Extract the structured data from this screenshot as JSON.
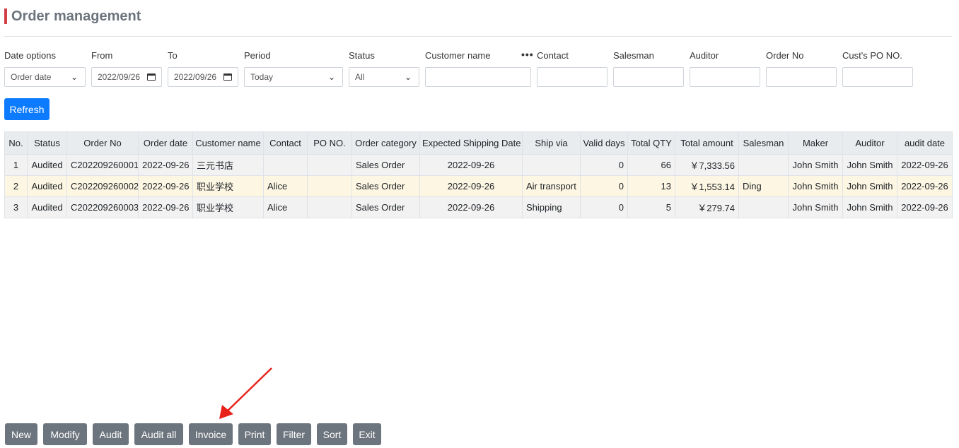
{
  "page": {
    "title": "Order management"
  },
  "filters": {
    "date_options": {
      "label": "Date options",
      "value": "Order date"
    },
    "from": {
      "label": "From",
      "value": "2022/09/26"
    },
    "to": {
      "label": "To",
      "value": "2022/09/26"
    },
    "period": {
      "label": "Period",
      "value": "Today"
    },
    "status": {
      "label": "Status",
      "value": "All"
    },
    "customer_name": {
      "label": "Customer name",
      "more": "•••",
      "value": ""
    },
    "contact": {
      "label": "Contact",
      "value": ""
    },
    "salesman": {
      "label": "Salesman",
      "value": ""
    },
    "auditor": {
      "label": "Auditor",
      "value": ""
    },
    "order_no": {
      "label": "Order No",
      "value": ""
    },
    "cust_po": {
      "label": "Cust's PO NO.",
      "value": ""
    }
  },
  "refresh_label": "Refresh",
  "table": {
    "columns": [
      "No.",
      "Status",
      "Order No",
      "Order date",
      "Customer name",
      "Contact",
      "PO NO.",
      "Order category",
      "Expected Shipping Date",
      "Ship via",
      "Valid days",
      "Total QTY",
      "Total amount",
      "Salesman",
      "Maker",
      "Auditor",
      "audit date"
    ],
    "rows": [
      [
        "1",
        "Audited",
        "C202209260001",
        "2022-09-26",
        "三元书店",
        "",
        "",
        "Sales Order",
        "2022-09-26",
        "",
        "0",
        "66",
        "￥7,333.56",
        "",
        "John Smith",
        "John Smith",
        "2022-09-26"
      ],
      [
        "2",
        "Audited",
        "C202209260002",
        "2022-09-26",
        "职业学校",
        "Alice",
        "",
        "Sales Order",
        "2022-09-26",
        "Air transport",
        "0",
        "13",
        "￥1,553.14",
        "Ding",
        "John Smith",
        "John Smith",
        "2022-09-26"
      ],
      [
        "3",
        "Audited",
        "C202209260003",
        "2022-09-26",
        "职业学校",
        "Alice",
        "",
        "Sales Order",
        "2022-09-26",
        "Shipping",
        "0",
        "5",
        "￥279.74",
        "",
        "John Smith",
        "John Smith",
        "2022-09-26"
      ]
    ]
  },
  "actions": {
    "new": "New",
    "modify": "Modify",
    "audit": "Audit",
    "audit_all": "Audit all",
    "invoice": "Invoice",
    "print": "Print",
    "filter": "Filter",
    "sort": "Sort",
    "exit": "Exit"
  },
  "colors": {
    "primary": "#0d7bff",
    "secondary": "#6c757d",
    "title_accent": "#d23f46",
    "arrow": "#e8211a"
  },
  "icons": {
    "dropdown": "chevron-down-icon",
    "date": "calendar-icon",
    "more": "ellipsis-icon",
    "annotation": "red-arrow-icon"
  }
}
